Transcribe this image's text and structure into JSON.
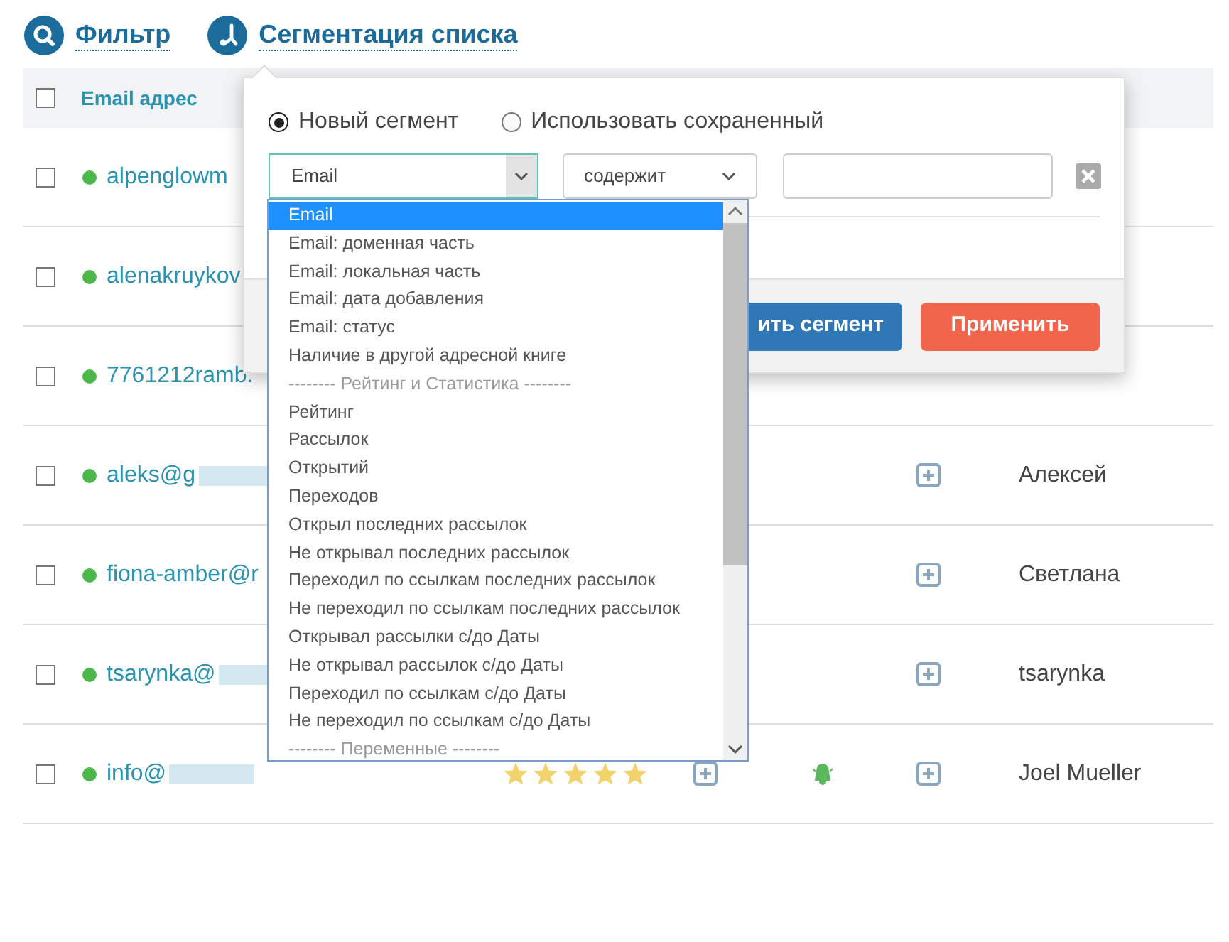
{
  "tabs": [
    {
      "label": "Фильтр",
      "kind": "search"
    },
    {
      "label": "Сегментация списка",
      "kind": "segment"
    }
  ],
  "table": {
    "columns": [
      "Email адрес"
    ],
    "select_all_checked": false,
    "rows": [
      {
        "checked": false,
        "email": "alpenglowm",
        "blurred": false
      },
      {
        "checked": false,
        "email": "alenakruykov",
        "blurred": false
      },
      {
        "checked": false,
        "email": "7761212ramb.",
        "blurred": false
      },
      {
        "checked": false,
        "email": "aleks@g",
        "blurred": true,
        "name": "Алексей"
      },
      {
        "checked": false,
        "email": "fiona-amber@r",
        "blurred": false,
        "name": "Светлана"
      },
      {
        "checked": false,
        "email": "tsarynka@",
        "blurred": true,
        "name": "tsarynka"
      },
      {
        "checked": false,
        "email": "info@",
        "blurred": true,
        "stars": 5,
        "alert": true,
        "name": "Joel Mueller"
      }
    ]
  },
  "segment_popup": {
    "radios": [
      {
        "label": "Новый сегмент",
        "selected": true
      },
      {
        "label": "Использовать сохраненный",
        "selected": false
      }
    ],
    "field_select": "Email",
    "operator_select": "содержит",
    "buttons": [
      {
        "label": "ить сегмент",
        "kind": "save"
      },
      {
        "label": "Применить",
        "kind": "apply"
      }
    ]
  },
  "field_dropdown": {
    "options": [
      {
        "label": "Email",
        "kind": "option",
        "selected": true
      },
      {
        "label": "Email: доменная часть",
        "kind": "option",
        "selected": false
      },
      {
        "label": "Email: локальная часть",
        "kind": "option",
        "selected": false
      },
      {
        "label": "Email: дата добавления",
        "kind": "option",
        "selected": false
      },
      {
        "label": "Email: статус",
        "kind": "option",
        "selected": false
      },
      {
        "label": "Наличие в другой адресной книге",
        "kind": "option",
        "selected": false
      },
      {
        "label": "-------- Рейтинг и Статистика --------",
        "kind": "group",
        "selected": false
      },
      {
        "label": "Рейтинг",
        "kind": "option",
        "selected": false
      },
      {
        "label": "Рассылок",
        "kind": "option",
        "selected": false
      },
      {
        "label": "Открытий",
        "kind": "option",
        "selected": false
      },
      {
        "label": "Переходов",
        "kind": "option",
        "selected": false
      },
      {
        "label": "Открыл последних рассылок",
        "kind": "option",
        "selected": false
      },
      {
        "label": "Не открывал последних рассылок",
        "kind": "option",
        "selected": false
      },
      {
        "label": "Переходил по ссылкам последних рассылок",
        "kind": "option",
        "selected": false
      },
      {
        "label": "Не переходил по ссылкам последних рассылок",
        "kind": "option",
        "selected": false
      },
      {
        "label": "Открывал рассылки с/до Даты",
        "kind": "option",
        "selected": false
      },
      {
        "label": "Не открывал рассылок с/до Даты",
        "kind": "option",
        "selected": false
      },
      {
        "label": "Переходил по ссылкам с/до Даты",
        "kind": "option",
        "selected": false
      },
      {
        "label": "Не переходил по ссылкам с/до Даты",
        "kind": "option",
        "selected": false
      },
      {
        "label": "-------- Переменные --------",
        "kind": "group",
        "selected": false
      }
    ]
  }
}
